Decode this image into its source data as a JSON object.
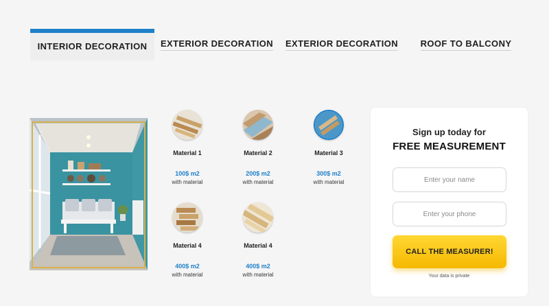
{
  "tabs": [
    {
      "label": "INTERIOR DECORATION",
      "active": true
    },
    {
      "label": "EXTERIOR DECORATION",
      "active": false
    },
    {
      "label": "EXTERIOR DECORATION",
      "active": false
    },
    {
      "label": "ROOF TO BALCONY",
      "active": false
    }
  ],
  "materials": [
    {
      "name": "Material 1",
      "price": "100$ m2",
      "note": "with material"
    },
    {
      "name": "Material 2",
      "price": "200$ m2",
      "note": "with material"
    },
    {
      "name": "Material 3",
      "price": "300$ m2",
      "note": "with material"
    },
    {
      "name": "Material 4",
      "price": "400$ m2",
      "note": "with material"
    },
    {
      "name": "Material 4",
      "price": "400$ m2",
      "note": "with material"
    }
  ],
  "form": {
    "title_line1": "Sign up today for",
    "title_line2": "FREE MEASUREMENT",
    "name_placeholder": "Enter your name",
    "phone_placeholder": "Enter your phone",
    "button_label": "CALL THE MEASURER!",
    "privacy_note": "Your data is private"
  },
  "colors": {
    "accent": "#1f80c9",
    "button": "#f5b800",
    "wall": "#3a93a0"
  }
}
